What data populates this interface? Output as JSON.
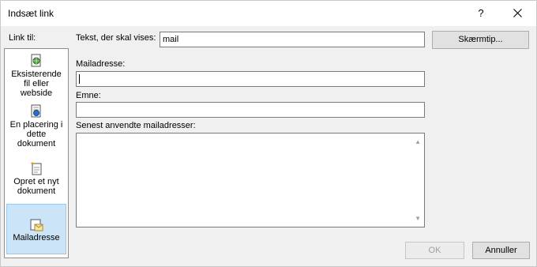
{
  "dialog": {
    "title": "Indsæt link",
    "help_label": "?"
  },
  "sidebar": {
    "heading": "Link til:",
    "items": [
      {
        "line1": "Eksisterende",
        "line2": "fil eller",
        "line3": "webside",
        "icon": "existing-file-web-page-icon"
      },
      {
        "line1": "En placering i",
        "line2": "dette",
        "line3": "dokument",
        "icon": "place-in-document-icon"
      },
      {
        "line1": "Opret et nyt",
        "line2": "dokument",
        "icon": "create-new-document-icon"
      },
      {
        "line1": "Mailadresse",
        "icon": "email-address-icon",
        "selected": true
      }
    ]
  },
  "text_to_display": {
    "label": "Tekst, der skal vises:",
    "value": "mail"
  },
  "screentip_button": "Skærmtip...",
  "email_address": {
    "label": "Mailadresse:",
    "value": ""
  },
  "subject": {
    "label": "Emne:",
    "value": ""
  },
  "recent_emails": {
    "label": "Senest anvendte mailadresser:",
    "items": []
  },
  "ok_button": "OK",
  "cancel_button": "Annuller"
}
